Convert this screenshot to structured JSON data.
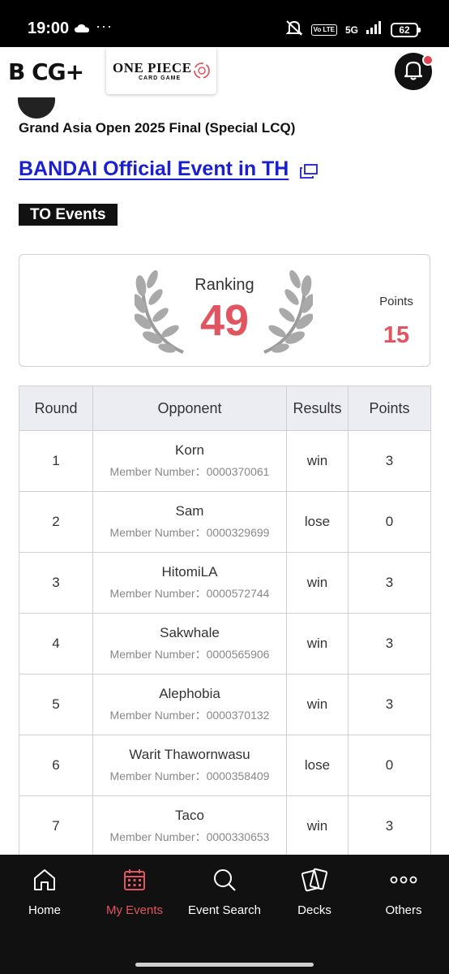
{
  "status_bar": {
    "time": "19:00",
    "dots": "···",
    "volte": "Vo LTE",
    "network": "5G",
    "battery": "62"
  },
  "header": {
    "brand_logo": "B CG+",
    "game_logo_title": "ONE PIECE",
    "game_logo_sub": "CARD GAME"
  },
  "event": {
    "title": "Grand Asia Open 2025 Final (Special LCQ)",
    "organizer": "BANDAI Official Event in TH",
    "tag": "TO Events"
  },
  "ranking": {
    "label": "Ranking",
    "value": "49",
    "points_label": "Points",
    "points_value": "15"
  },
  "table": {
    "headers": [
      "Round",
      "Opponent",
      "Results",
      "Points"
    ],
    "member_prefix": "Member Number：",
    "rows": [
      {
        "round": "1",
        "name": "Korn",
        "member": "Member Number：0000370061",
        "result": "win",
        "points": "3"
      },
      {
        "round": "2",
        "name": "Sam",
        "member": "Member Number：0000329699",
        "result": "lose",
        "points": "0"
      },
      {
        "round": "3",
        "name": "HitomiLA",
        "member": "Member Number：0000572744",
        "result": "win",
        "points": "3"
      },
      {
        "round": "4",
        "name": "Sakwhale",
        "member": "Member Number：0000565906",
        "result": "win",
        "points": "3"
      },
      {
        "round": "5",
        "name": "Alephobia",
        "member": "Member Number：0000370132",
        "result": "win",
        "points": "3"
      },
      {
        "round": "6",
        "name": "Warit Thawornwasu",
        "member": "Member Number：0000358409",
        "result": "lose",
        "points": "0"
      },
      {
        "round": "7",
        "name": "Taco",
        "member": "Member Number：0000330653",
        "result": "win",
        "points": "3"
      }
    ]
  },
  "nav": {
    "items": [
      {
        "label": "Home",
        "icon": "home-icon"
      },
      {
        "label": "My Events",
        "icon": "calendar-icon"
      },
      {
        "label": "Event Search",
        "icon": "search-icon"
      },
      {
        "label": "Decks",
        "icon": "cards-icon"
      },
      {
        "label": "Others",
        "icon": "more-icon"
      }
    ],
    "active": "My Events"
  },
  "colors": {
    "accent": "#e05560",
    "link": "#1a1fd1",
    "dark": "#111111"
  }
}
